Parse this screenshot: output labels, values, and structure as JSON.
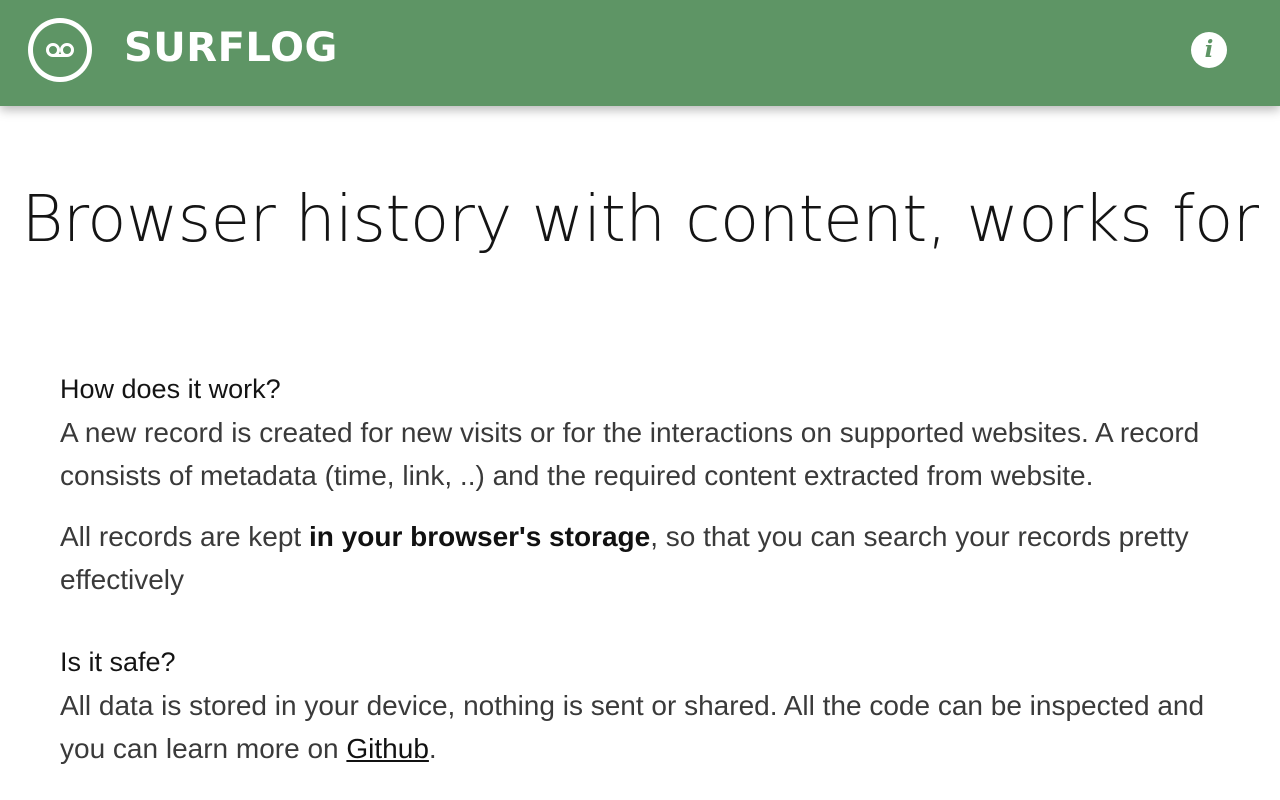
{
  "header": {
    "logo_icon": "voicemail-icon",
    "title": "SURFLOG",
    "info_label": "i",
    "info_icon": "info-icon",
    "bg_color": "#5e9565"
  },
  "hero": {
    "title": "Browser history with content, works for"
  },
  "how": {
    "heading": "How does it work?",
    "p1": "A new record is created for new visits or for the interactions on supported websites. A record consists of metadata (time, link, ..) and the required content extracted from website.",
    "p2_pre": "All records are kept ",
    "p2_bold": "in your browser's storage",
    "p2_post": ", so that you can search your records pretty effectively"
  },
  "safe": {
    "heading": "Is it safe?",
    "p_pre": "All data is stored in your device, nothing is sent or shared. All the code can be inspected and you can learn more on ",
    "link": "Github",
    "p_post": "."
  }
}
